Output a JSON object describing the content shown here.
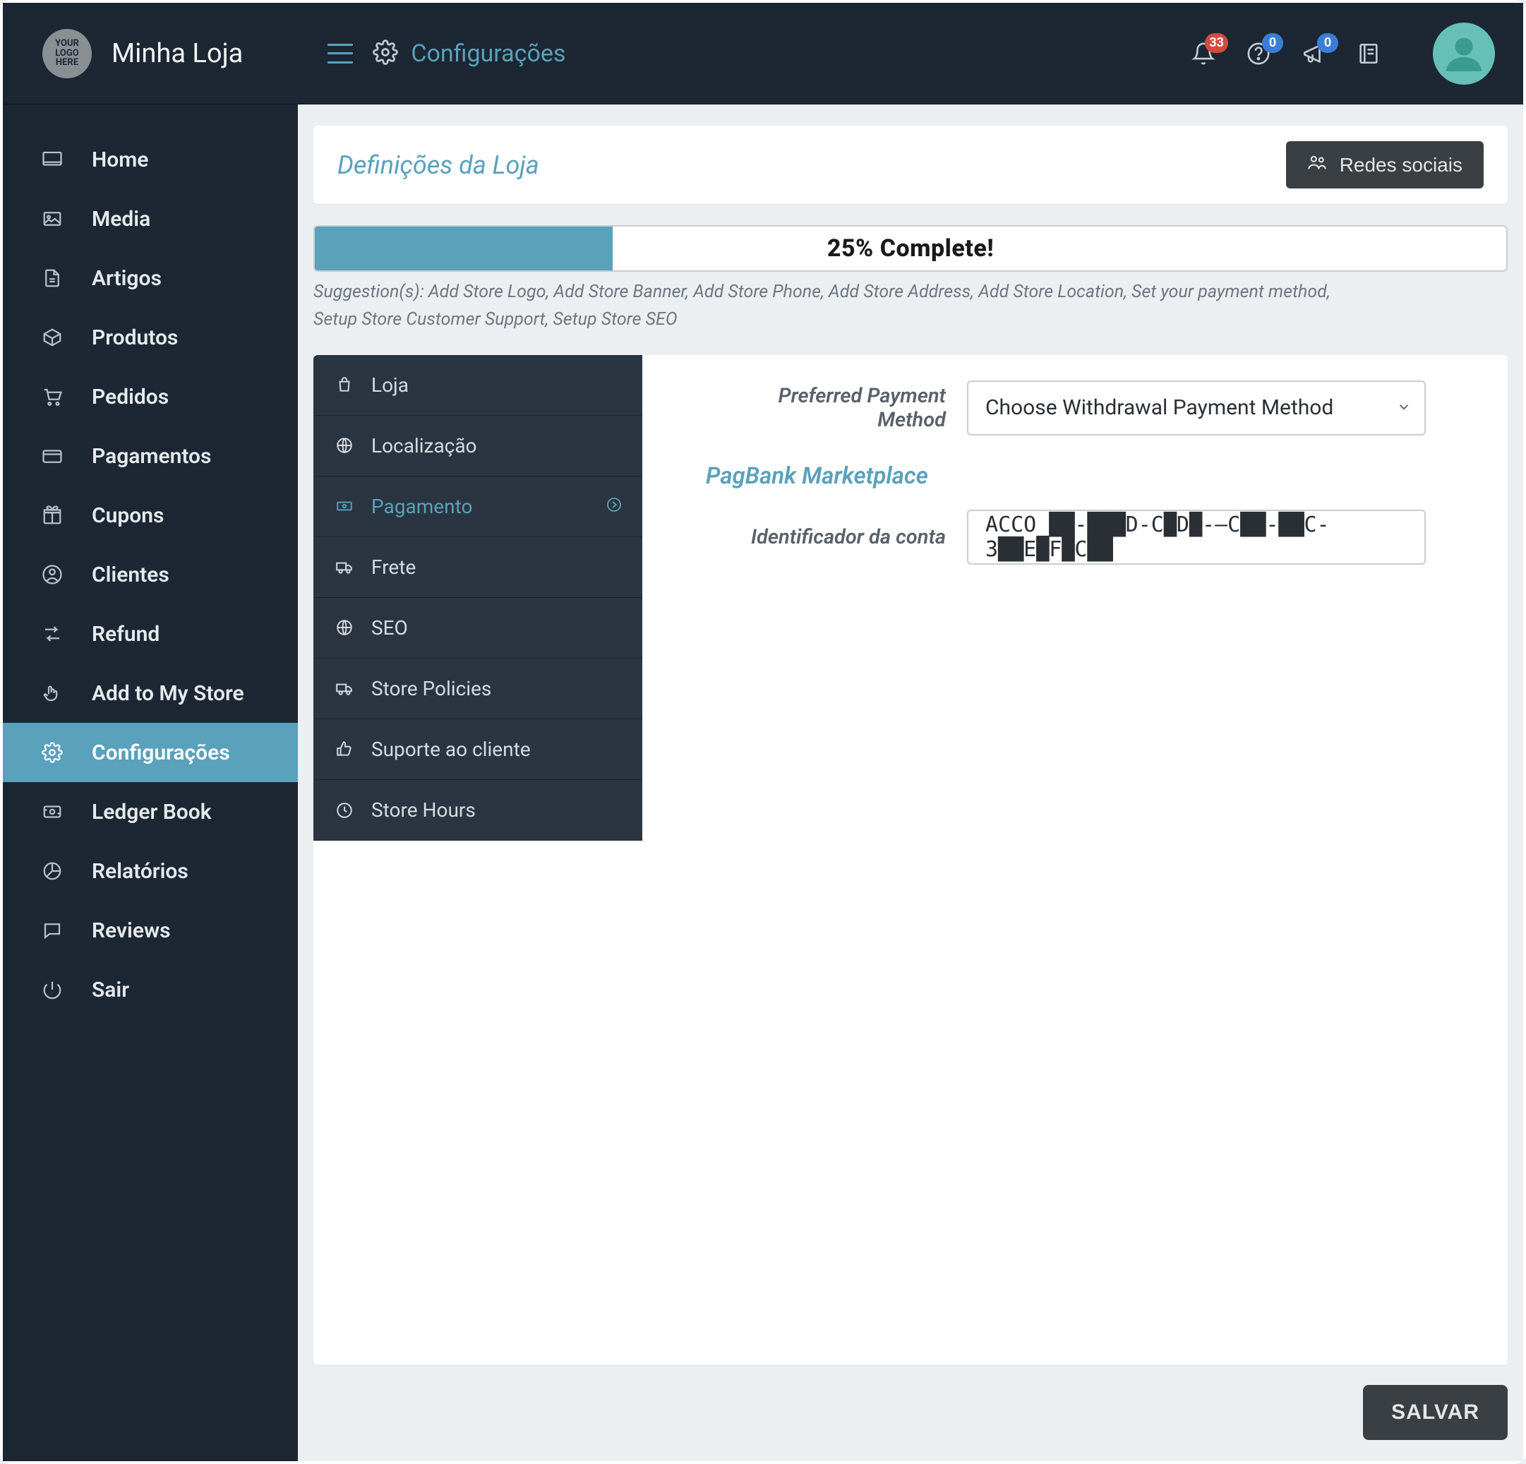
{
  "topbar": {
    "logo_text": "YOUR LOGO HERE",
    "store_name": "Minha Loja",
    "page_title": "Configurações",
    "notifications_count": "33",
    "help_count": "0",
    "announce_count": "0"
  },
  "sidebar": {
    "items": [
      {
        "label": "Home"
      },
      {
        "label": "Media"
      },
      {
        "label": "Artigos"
      },
      {
        "label": "Produtos"
      },
      {
        "label": "Pedidos"
      },
      {
        "label": "Pagamentos"
      },
      {
        "label": "Cupons"
      },
      {
        "label": "Clientes"
      },
      {
        "label": "Refund"
      },
      {
        "label": "Add to My Store"
      },
      {
        "label": "Configurações"
      },
      {
        "label": "Ledger Book"
      },
      {
        "label": "Relatórios"
      },
      {
        "label": "Reviews"
      },
      {
        "label": "Sair"
      }
    ]
  },
  "header_card": {
    "title": "Definições da Loja",
    "social_btn": "Redes sociais"
  },
  "progress": {
    "percent": 25,
    "label": "25% Complete!"
  },
  "suggestions_label": "Suggestion(s): ",
  "suggestions_line1": "Add Store Logo, Add Store Banner, Add Store Phone, Add Store Address, Add Store Location, Set your payment method,",
  "suggestions_line2": "Setup Store Customer Support, Setup Store SEO",
  "tabs": [
    {
      "label": "Loja"
    },
    {
      "label": "Localização"
    },
    {
      "label": "Pagamento"
    },
    {
      "label": "Frete"
    },
    {
      "label": "SEO"
    },
    {
      "label": "Store Policies"
    },
    {
      "label": "Suporte ao cliente"
    },
    {
      "label": "Store Hours"
    }
  ],
  "form": {
    "preferred_label": "Preferred Payment Method",
    "preferred_value": "Choose Withdrawal Payment Method",
    "section_heading": "PagBank Marketplace",
    "account_id_label": "Identificador da conta",
    "account_id_value": "ACCO_██-███D-C█D█-—C██-██C-3██E█F█C██"
  },
  "save_label": "SALVAR"
}
